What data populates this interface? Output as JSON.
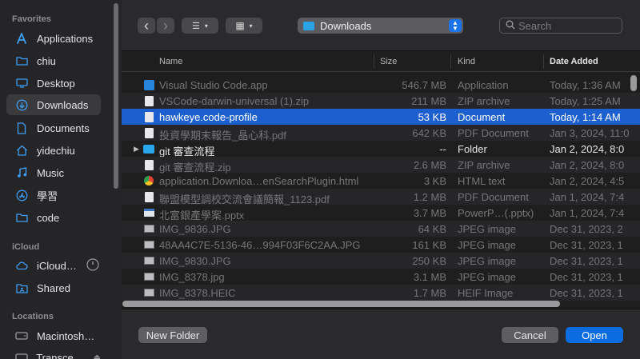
{
  "sidebar": {
    "sections": {
      "favorites": "Favorites",
      "icloud": "iCloud",
      "locations": "Locations"
    },
    "favorites": [
      {
        "label": "Applications",
        "icon": "applications-icon"
      },
      {
        "label": "chiu",
        "icon": "folder-icon"
      },
      {
        "label": "Desktop",
        "icon": "desktop-icon"
      },
      {
        "label": "Downloads",
        "icon": "downloads-icon",
        "selected": true
      },
      {
        "label": "Documents",
        "icon": "document-icon"
      },
      {
        "label": "yidechiu",
        "icon": "home-icon"
      },
      {
        "label": "Music",
        "icon": "music-icon"
      },
      {
        "label": "學習",
        "icon": "app-store-icon"
      },
      {
        "label": "code",
        "icon": "folder-icon"
      }
    ],
    "icloud": [
      {
        "label": "iCloud…",
        "icon": "cloud-icon"
      },
      {
        "label": "Shared",
        "icon": "shared-folder-icon"
      }
    ],
    "locations": [
      {
        "label": "Macintosh…",
        "icon": "disk-icon"
      },
      {
        "label": "Transce…",
        "icon": "external-disk-icon"
      }
    ]
  },
  "toolbar": {
    "back": "‹",
    "forward": "›",
    "view_list": "☰",
    "view_grid": "▦",
    "location": "Downloads",
    "search_placeholder": "Search"
  },
  "columns": {
    "name": "Name",
    "size": "Size",
    "kind": "Kind",
    "date": "Date Added"
  },
  "files": [
    {
      "name": "Visual Studio Code.app",
      "size": "546.7 MB",
      "kind": "Application",
      "date": "Today, 1:36 AM",
      "icon": "vscode-icon"
    },
    {
      "name": "VSCode-darwin-universal (1).zip",
      "size": "211 MB",
      "kind": "ZIP archive",
      "date": "Today, 1:25 AM",
      "icon": "zip-icon"
    },
    {
      "name": "hawkeye.code-profile",
      "size": "53 KB",
      "kind": "Document",
      "date": "Today, 1:14 AM",
      "icon": "document-icon",
      "selected": true
    },
    {
      "name": "投資學期末報告_晶心科.pdf",
      "size": "642 KB",
      "kind": "PDF Document",
      "date": "Jan 3, 2024, 11:0",
      "icon": "pdf-icon"
    },
    {
      "name": "git 審查流程",
      "size": "--",
      "kind": "Folder",
      "date": "Jan 2, 2024, 8:0",
      "icon": "folder-icon",
      "folder": true
    },
    {
      "name": "git 審查流程.zip",
      "size": "2.6 MB",
      "kind": "ZIP archive",
      "date": "Jan 2, 2024, 8:0",
      "icon": "zip-icon"
    },
    {
      "name": "application.Downloa…enSearchPlugin.html",
      "size": "3 KB",
      "kind": "HTML text",
      "date": "Jan 2, 2024, 4:5",
      "icon": "chrome-icon"
    },
    {
      "name": "聯盟模型調校交流會議簡報_1123.pdf",
      "size": "1.2 MB",
      "kind": "PDF Document",
      "date": "Jan 1, 2024, 7:4",
      "icon": "pdf-icon"
    },
    {
      "name": "北富銀產學案.pptx",
      "size": "3.7 MB",
      "kind": "PowerP…(.pptx)",
      "date": "Jan 1, 2024, 7:4",
      "icon": "pptx-icon"
    },
    {
      "name": "IMG_9836.JPG",
      "size": "64 KB",
      "kind": "JPEG image",
      "date": "Dec 31, 2023, 2",
      "icon": "image-icon"
    },
    {
      "name": "48AA4C7E-5136-46…994F03F6C2AA.JPG",
      "size": "161 KB",
      "kind": "JPEG image",
      "date": "Dec 31, 2023, 1",
      "icon": "image-icon"
    },
    {
      "name": "IMG_9830.JPG",
      "size": "250 KB",
      "kind": "JPEG image",
      "date": "Dec 31, 2023, 1",
      "icon": "image-icon"
    },
    {
      "name": "IMG_8378.jpg",
      "size": "3.1 MB",
      "kind": "JPEG image",
      "date": "Dec 31, 2023, 1",
      "icon": "image-icon"
    },
    {
      "name": "IMG_8378.HEIC",
      "size": "1.7 MB",
      "kind": "HEIF Image",
      "date": "Dec 31, 2023, 1",
      "icon": "image-icon"
    }
  ],
  "footer": {
    "new_folder": "New Folder",
    "cancel": "Cancel",
    "open": "Open"
  }
}
